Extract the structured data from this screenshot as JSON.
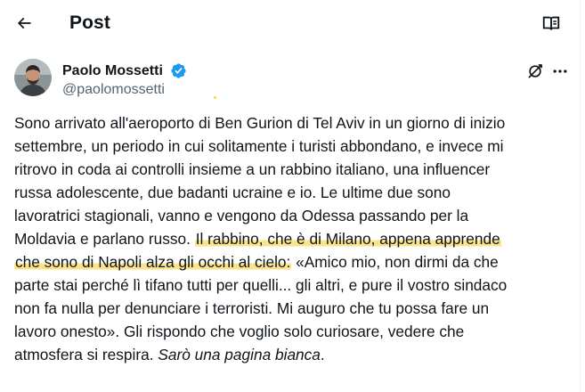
{
  "header": {
    "title": "Post"
  },
  "author": {
    "name": "Paolo Mossetti",
    "handle": "@paolomossetti",
    "verified": true
  },
  "icons": {
    "back": "arrow-left-icon",
    "reader": "book-open-icon",
    "grok": "grok-icon",
    "more": "more-horizontal-icon",
    "verified": "verified-badge-icon"
  },
  "colors": {
    "text": "#0f1419",
    "secondary_text": "#536471",
    "verified_blue": "#1d9bf0",
    "highlight": "#fade78"
  },
  "tweet": {
    "lines": [
      [
        "Sono arrivato all'aeroporto di Ben Gurion di Tel Aviv in un giorno di inizio"
      ],
      [
        "settembre, un periodo in cui solitamente i turisti abbondano, e invece mi"
      ],
      [
        "ritrovo in coda ai controlli insieme a un rabbino italiano, una influencer"
      ],
      [
        "russa adolescente, due badanti ucraine e io. Le ultime due sono"
      ],
      [
        "lavoratrici stagionali, vanno e vengono da Odessa passando per la"
      ],
      [
        "Moldavia e parlano russo. ",
        "Il rabbino, che è di Milano, appena apprende"
      ],
      [
        "che sono di Napoli alza gli occhi al cielo:",
        " «Amico mio, non dirmi da che"
      ],
      [
        "parte stai perché lì tifano tutti per quelli... gli altri, e pure il vostro sindaco"
      ],
      [
        "non fa nulla per denunciare i terroristi. Mi auguro che tu possa fare un"
      ],
      [
        "lavoro onesto». Gli rispondo che voglio solo curiosare, vedere che"
      ],
      [
        "atmosfera si respira. ",
        "Sarò una pagina bianca",
        "."
      ]
    ]
  }
}
